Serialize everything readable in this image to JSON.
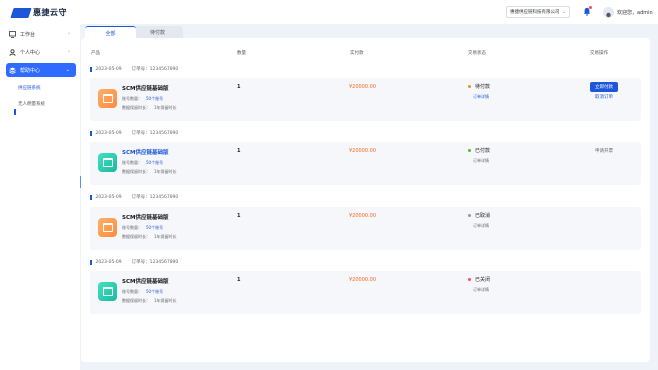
{
  "header": {
    "logo_text": "惠捷云守",
    "company_select": "惠捷供应链科技有限公司",
    "welcome": "欢迎您，admin"
  },
  "sidebar": {
    "items": [
      {
        "label": "工作台",
        "icon": "monitor-icon"
      },
      {
        "label": "个人中心",
        "icon": "user-icon"
      },
      {
        "label": "帮助中心",
        "icon": "stack-icon"
      }
    ],
    "sub_items": [
      "供应链系统",
      "无人佣量系统"
    ]
  },
  "tabs": [
    "全部",
    "待付款"
  ],
  "table": {
    "headers": [
      "产品",
      "数量",
      "实付款",
      "交易状态",
      "交易操作"
    ]
  },
  "orders": [
    {
      "date": "2023-05-09",
      "order_no": "订单号：1234567890",
      "name": "SCM供应链基础版",
      "account_label": "账号数量：",
      "account_value": "50个账号",
      "duration_label": "数据保留时长：",
      "duration_value": "1年保留时长",
      "qty": "1",
      "price": "¥20000.00",
      "status": "待付款",
      "status_color": "#fa8c16",
      "detail": "订单详情",
      "action_primary": "立即付款",
      "action_secondary": "取消订单"
    },
    {
      "date": "2023-05-09",
      "order_no": "订单号：1234567890",
      "name": "SCM供应链基础版",
      "account_label": "账号数量：",
      "account_value": "50个账号",
      "duration_label": "数据保留时长：",
      "duration_value": "1年保留时长",
      "qty": "1",
      "price": "¥20000.00",
      "status": "已付款",
      "status_color": "#52c41a",
      "detail": "订单详情",
      "action_text": "申请开票"
    },
    {
      "date": "2023-05-09",
      "order_no": "订单号：1234567890",
      "name": "SCM供应链基础版",
      "account_label": "账号数量：",
      "account_value": "50个账号",
      "duration_label": "数据保留时长：",
      "duration_value": "1年保留时长",
      "qty": "1",
      "price": "¥20000.00",
      "status": "已取消",
      "status_color": "#999999",
      "detail": "订单详情"
    },
    {
      "date": "2023-05-09",
      "order_no": "订单号：1234567890",
      "name": "SCM供应链基础版",
      "account_label": "账号数量：",
      "account_value": "50个账号",
      "duration_label": "数据保留时长：",
      "duration_value": "1年保留时长",
      "qty": "1",
      "price": "¥20000.00",
      "status": "已关闭",
      "status_color": "#ff4d4f",
      "detail": "订单详情"
    }
  ],
  "colors": {
    "accent": "#1e56d9",
    "price": "#fa6a1e",
    "panel_bg": "#f5f7fb"
  }
}
